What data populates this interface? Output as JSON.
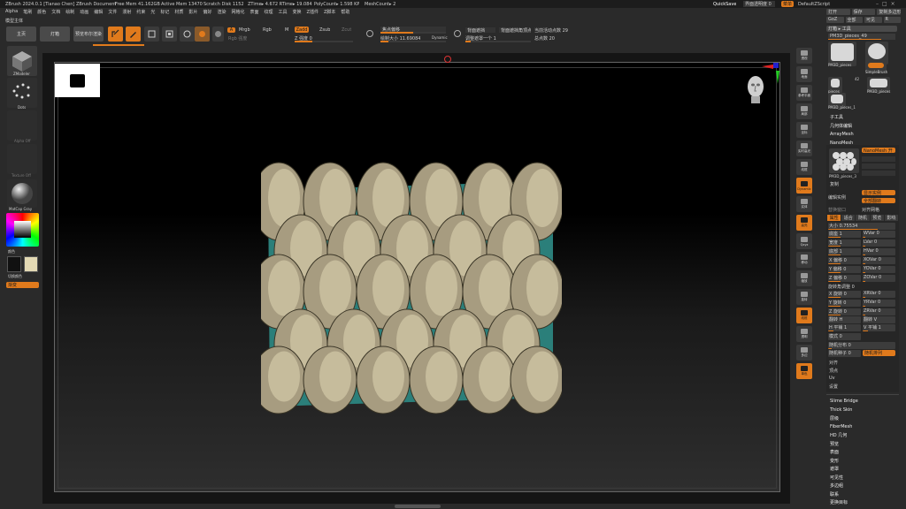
{
  "titlebar": {
    "title": "ZBrush 2024.0.1 [Tianao Chen]",
    "doc": "ZBrush Document",
    "free_mem": "Free Mem 41.162GB",
    "active_mem": "Active Mem 13470",
    "scratch": "Scratch Disk 1152",
    "ztime": "ZTime▸ 4.672 RTime▸ 19.084",
    "polycount": "PolyCount▸ 1.598 KP",
    "meshcount": "MeshCount▸ 2",
    "quicksave": "QuickSave",
    "transparency": "界面透明度 0",
    "menu_btn": "菜单",
    "script": "DefaultZScript"
  },
  "menubar": [
    "Alpha",
    "笔刷",
    "颜色",
    "文档",
    "绘制",
    "动画",
    "编辑",
    "文件",
    "漫射",
    "约束",
    "光",
    "标记",
    "材质",
    "影片",
    "偏好",
    "渲染",
    "网格化",
    "表面",
    "纹理",
    "工具",
    "变换",
    "Z插件",
    "Z脚本",
    "帮助"
  ],
  "subheader": "模型主体",
  "toolbar": {
    "home": "主页",
    "lightbox": "灯箱",
    "quick_sketch": "预览布尔渲染",
    "a_label": "A",
    "mrgb": "Mrgb",
    "rgb": "Rgb",
    "m": "M",
    "zadd": "Zadd",
    "zsub": "Zsub",
    "zcut": "Zcut",
    "rgb_intensity": "Rgb 强度",
    "z_intensity": "Z 强度 0",
    "focal_shift": "焦点偏移",
    "draw_size": "绘制大小 11.69084",
    "dynamic": "Dynamic",
    "backface": "背面遮挡",
    "backface_mask": "背面遮挡角顶点",
    "adjust": "调整遮罩一个 1",
    "active_points": "当前活动点数 29",
    "total_points": "总点数 20"
  },
  "left_panel": {
    "tool_label": "ZModeler",
    "dots_label": "Dots",
    "alpha_off": "Alpha Off",
    "texture_off": "Texture Off",
    "material_label": "MatCap Gray",
    "color_label": "颜色",
    "switch_color": "切换颜色",
    "gradient": "渐变"
  },
  "right_strip": [
    "透视",
    "地面",
    "参考平面",
    "局部",
    "坐标",
    "实时高光",
    "线框",
    "Dynamic",
    "实体",
    "高亮",
    "Qxyz",
    "移动",
    "缩放",
    "旋转",
    "线框",
    "透明",
    "多边",
    "单色"
  ],
  "right_panel": {
    "header_tabs": [
      "打开",
      "保存",
      "复制多边形网格体"
    ],
    "row2": [
      "GoZ",
      "全部",
      "可见",
      "R"
    ],
    "lightbox_tools": "灯箱 ▸ 工具",
    "current_tool": "PM3D_pieces_49",
    "thumbs": [
      "PM3D_pieces",
      "Cylinder3D",
      "SimpleBrush",
      "pieces",
      "PM3D_pieces",
      "PM3D_pieces_1"
    ],
    "badge_42": "42",
    "sections": [
      "子工具",
      "几何体编辑",
      "ArrayMesh",
      "NanoMesh"
    ],
    "nanomesh_on": "NanoMesh 开",
    "nanomesh_thumb": "PM3D_pieces_3",
    "nm_copy": "复制",
    "nm_edit": "编辑实例",
    "show_instances": "显示实例",
    "flip_all": "全部翻转",
    "prop_window": "替换窗口",
    "align": "对齐网格",
    "subtabs": [
      "属性",
      "适合",
      "随机",
      "预览",
      "影响"
    ],
    "size": "大小 0.75534",
    "sliders": [
      [
        "底座 1",
        "WVar 0"
      ],
      [
        "宽度 1",
        "LVar 0"
      ],
      [
        "底部 1",
        "HVar 0"
      ],
      [
        "X 偏移 0",
        "XOVar 0"
      ],
      [
        "Y 偏移 0",
        "YOVar 0"
      ],
      [
        "Z 偏移 0",
        "ZOVar 0"
      ]
    ],
    "angle_label": "旋转角调整 0",
    "rot_sliders": [
      [
        "X 旋转 0",
        "XRVar 0"
      ],
      [
        "Y 旋转 0",
        "YRVar 0"
      ],
      [
        "Z 旋转 0",
        "ZRVar 0"
      ]
    ],
    "flip": [
      "翻转 H",
      "翻转 V"
    ],
    "flat": [
      "H 平铺 1",
      "V 平铺 1"
    ],
    "mode": "模式 0",
    "random_dist": "随机分布 0",
    "random_seed": "随机种子 0",
    "random_arrange": "随机排列",
    "extras": [
      "对齐",
      "顶点",
      "Uv",
      "设置"
    ],
    "lower_menu": [
      "Slime Bridge",
      "Thick Skin",
      "层级",
      "FiberMesh",
      "HD 几何",
      "预览",
      "表面",
      "变形",
      "遮罩",
      "可见性",
      "多边组",
      "联系",
      "更换目标"
    ]
  },
  "colors": {
    "accent": "#e07a1c",
    "teal": "#2b7f7a",
    "scale": "#a79c80"
  }
}
